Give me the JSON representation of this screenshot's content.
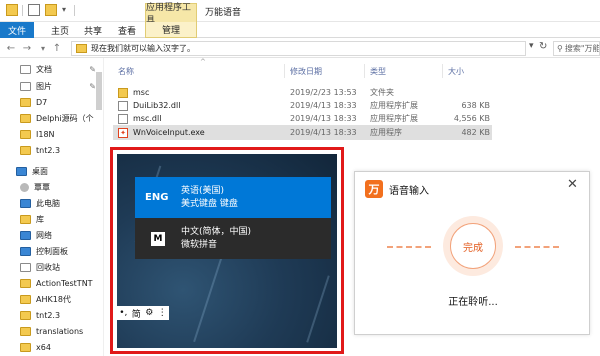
{
  "window": {
    "context_tab": "应用程序工具",
    "title": "万能语音"
  },
  "ribbon": {
    "tabs": [
      "文件",
      "主页",
      "共享",
      "查看",
      "管理"
    ]
  },
  "address": {
    "path": "现在我们就可以输入汉字了。",
    "search_placeholder": "搜索\"万能语音\""
  },
  "nav": {
    "items": [
      {
        "label": "文档",
        "icon": "documents-icon",
        "pinned": true
      },
      {
        "label": "图片",
        "icon": "pictures-icon",
        "pinned": true
      },
      {
        "label": "D7",
        "icon": "folder-icon"
      },
      {
        "label": "Delphi源码（个",
        "icon": "folder-icon"
      },
      {
        "label": "I18N",
        "icon": "folder-icon"
      },
      {
        "label": "tnt2.3",
        "icon": "folder-icon"
      },
      {
        "label": "桌面",
        "icon": "desktop-icon"
      },
      {
        "label": "覃覃",
        "icon": "user-icon"
      },
      {
        "label": "此电脑",
        "icon": "computer-icon"
      },
      {
        "label": "库",
        "icon": "library-icon"
      },
      {
        "label": "网络",
        "icon": "network-icon"
      },
      {
        "label": "控制面板",
        "icon": "control-panel-icon"
      },
      {
        "label": "回收站",
        "icon": "recycle-bin-icon"
      },
      {
        "label": "ActionTestTNT",
        "icon": "folder-icon"
      },
      {
        "label": "AHK18代",
        "icon": "folder-icon"
      },
      {
        "label": "tnt2.3",
        "icon": "folder-icon"
      },
      {
        "label": "translations",
        "icon": "folder-icon"
      },
      {
        "label": "x64",
        "icon": "folder-icon"
      }
    ]
  },
  "files": {
    "columns": [
      "名称",
      "修改日期",
      "类型",
      "大小"
    ],
    "rows": [
      {
        "name": "msc",
        "date": "2019/2/23 13:53",
        "type": "文件夹",
        "size": "",
        "icon": "folder-icon"
      },
      {
        "name": "DuiLib32.dll",
        "date": "2019/4/13 18:33",
        "type": "应用程序扩展",
        "size": "638 KB",
        "icon": "dll-icon"
      },
      {
        "name": "msc.dll",
        "date": "2019/4/13 18:33",
        "type": "应用程序扩展",
        "size": "4,556 KB",
        "icon": "dll-icon"
      },
      {
        "name": "WnVoiceInput.exe",
        "date": "2019/4/13 18:33",
        "type": "应用程序",
        "size": "482 KB",
        "icon": "exe-icon",
        "selected": true
      }
    ]
  },
  "language_menu": {
    "items": [
      {
        "code": "ENG",
        "line1": "英语(美国)",
        "line2": "美式键盘 键盘",
        "active": true
      },
      {
        "code": "M",
        "line1": "中文(简体，中国)",
        "line2": "微软拼音",
        "active": false
      }
    ],
    "ime_bar": {
      "punct": "•,",
      "mode": "简",
      "settings": "⚙",
      "more": "⋮"
    }
  },
  "voice_panel": {
    "title": "语音输入",
    "close": "✕",
    "logo": "万",
    "button": "完成",
    "status": "正在聆听..."
  },
  "colors": {
    "ribbon_blue": "#1979ca",
    "highlight_red": "#e11919",
    "menu_active": "#0078d7",
    "voice_accent": "#f2701e"
  }
}
